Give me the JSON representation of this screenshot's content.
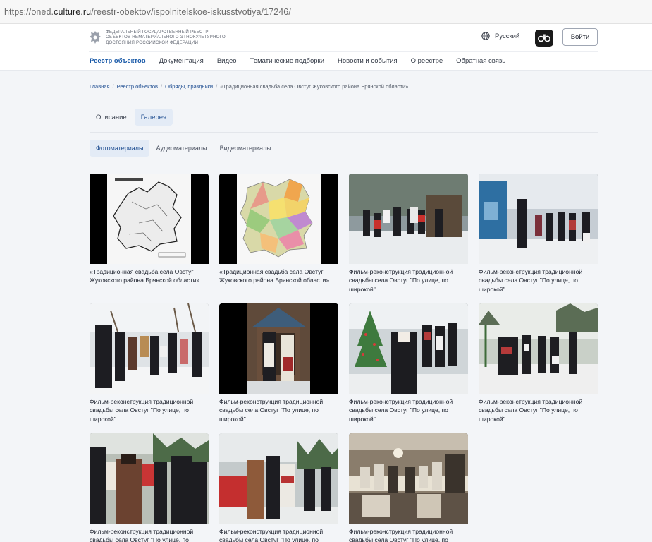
{
  "browser": {
    "url_prefix": "https://oned.",
    "url_domain": "culture.ru",
    "url_suffix": "/reestr-obektov/ispolnitelskoe-iskusstvotiya/17246/"
  },
  "header": {
    "logo_line1": "Федеральный государственный реестр",
    "logo_line2": "объектов нематериального этнокультурного",
    "logo_line3": "достояния Российской Федерации",
    "language": "Русский",
    "login": "Войти"
  },
  "nav": {
    "items": [
      "Реестр объектов",
      "Документация",
      "Видео",
      "Тематические подборки",
      "Новости и события",
      "О реестре",
      "Обратная связь"
    ]
  },
  "breadcrumb": {
    "home": "Главная",
    "registry": "Реестр объектов",
    "category": "Обряды, праздники",
    "current": "«Традиционная свадьба села Овстуг Жуковского района Брянской области»"
  },
  "tabs": [
    "Описание",
    "Галерея"
  ],
  "subtabs": [
    "Фотоматериалы",
    "Аудиоматериалы",
    "Видеоматериалы"
  ],
  "gallery": [
    {
      "caption": "«Традиционная свадьба села Овстуг Жуковского района Брянской области»",
      "image": "map-zhukovsky-district"
    },
    {
      "caption": "«Традиционная свадьба села Овстуг Жуковского района Брянской области»",
      "image": "map-bryansk-region"
    },
    {
      "caption": "Фильм-реконструкция традиционной свадьбы села Овстуг \"По улице, по широкой\"",
      "image": "photo-winter-procession"
    },
    {
      "caption": "Фильм-реконструкция традиционной свадьбы села Овстуг \"По улице, по широкой\"",
      "image": "photo-house-porch"
    },
    {
      "caption": "Фильм-реконструкция традиционной свадьбы села Овстуг \"По улице, по широкой\"",
      "image": "photo-villagers-street"
    },
    {
      "caption": "Фильм-реконструкция традиционной свадьбы села Овстуг \"По улице, по широкой\"",
      "image": "photo-couple-doorway"
    },
    {
      "caption": "Фильм-реконструкция традиционной свадьбы села Овстуг \"По улице, по широкой\"",
      "image": "photo-wedding-tree"
    },
    {
      "caption": "Фильм-реконструкция традиционной свадьбы села Овстуг \"По улице, по широкой\"",
      "image": "photo-women-singing"
    },
    {
      "caption": "Фильм-реконструкция традиционной свадьбы села Овстуг \"По улице, по широкой\"",
      "image": "photo-group-close"
    },
    {
      "caption": "Фильм-реконструкция традиционной свадьбы села Овстуг \"По улице, по широкой\"",
      "image": "photo-red-cart"
    },
    {
      "caption": "Фильм-реконструкция традиционной свадьбы села Овстуг \"По улице, по широкой\"",
      "image": "photo-feast-table"
    }
  ],
  "colors": {
    "accent": "#1a5aa8",
    "tab_active_bg": "#e3ebf6",
    "page_bg": "#f3f5f8"
  }
}
